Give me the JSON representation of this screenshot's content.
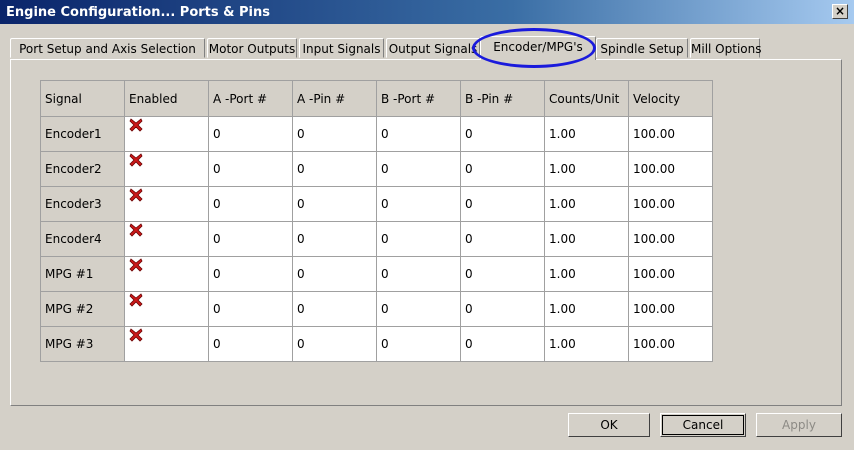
{
  "window": {
    "title": "Engine Configuration... Ports & Pins",
    "close_label": "×"
  },
  "tabs": [
    {
      "label": "Port Setup and Axis Selection"
    },
    {
      "label": "Motor Outputs"
    },
    {
      "label": "Input Signals"
    },
    {
      "label": "Output Signals"
    },
    {
      "label": "Encoder/MPG's"
    },
    {
      "label": "Spindle Setup"
    },
    {
      "label": "Mill Options"
    }
  ],
  "active_tab": "Encoder/MPG's",
  "table": {
    "columns": [
      "Signal",
      "Enabled",
      "A -Port #",
      "A -Pin  #",
      "B -Port #",
      "B -Pin  #",
      "Counts/Unit",
      "Velocity"
    ],
    "rows": [
      {
        "signal": "Encoder1",
        "enabled": "red-x-icon",
        "a_port": "0",
        "a_pin": "0",
        "b_port": "0",
        "b_pin": "0",
        "counts": "1.00",
        "velocity": "100.00"
      },
      {
        "signal": "Encoder2",
        "enabled": "red-x-icon",
        "a_port": "0",
        "a_pin": "0",
        "b_port": "0",
        "b_pin": "0",
        "counts": "1.00",
        "velocity": "100.00"
      },
      {
        "signal": "Encoder3",
        "enabled": "red-x-icon",
        "a_port": "0",
        "a_pin": "0",
        "b_port": "0",
        "b_pin": "0",
        "counts": "1.00",
        "velocity": "100.00"
      },
      {
        "signal": "Encoder4",
        "enabled": "red-x-icon",
        "a_port": "0",
        "a_pin": "0",
        "b_port": "0",
        "b_pin": "0",
        "counts": "1.00",
        "velocity": "100.00"
      },
      {
        "signal": "MPG #1",
        "enabled": "red-x-icon",
        "a_port": "0",
        "a_pin": "0",
        "b_port": "0",
        "b_pin": "0",
        "counts": "1.00",
        "velocity": "100.00"
      },
      {
        "signal": "MPG #2",
        "enabled": "red-x-icon",
        "a_port": "0",
        "a_pin": "0",
        "b_port": "0",
        "b_pin": "0",
        "counts": "1.00",
        "velocity": "100.00"
      },
      {
        "signal": "MPG #3",
        "enabled": "red-x-icon",
        "a_port": "0",
        "a_pin": "0",
        "b_port": "0",
        "b_pin": "0",
        "counts": "1.00",
        "velocity": "100.00"
      }
    ]
  },
  "buttons": {
    "ok": "OK",
    "cancel": "Cancel",
    "apply": "Apply"
  },
  "colors": {
    "title_bar": "#0a246a",
    "highlight_circle": "#1a1adc",
    "disabled_x": "#cc1a1a"
  }
}
